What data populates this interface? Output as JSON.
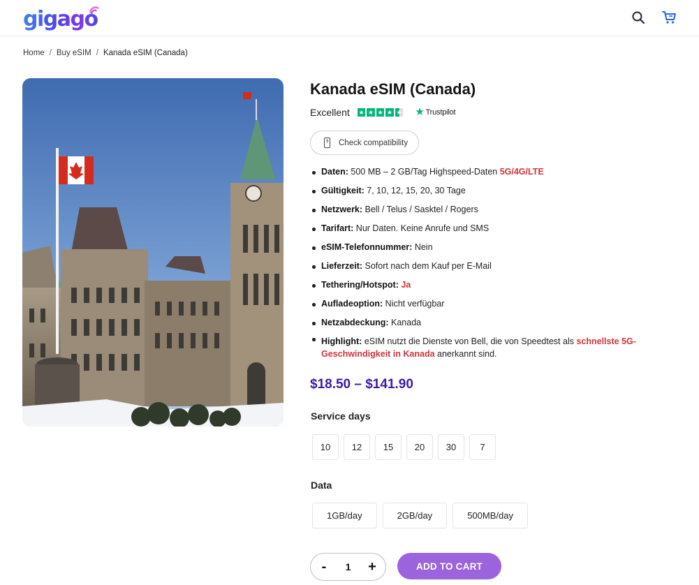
{
  "header": {
    "logo_text": "gigago",
    "search_icon": "search-icon",
    "cart_icon": "cart-icon"
  },
  "breadcrumb": [
    "Home",
    "Buy eSIM",
    "Kanada eSIM (Canada)"
  ],
  "product": {
    "title": "Kanada eSIM (Canada)",
    "rating_label": "Excellent",
    "trustpilot_label": "Trustpilot",
    "rating_stars": 4.5,
    "compat_label": "Check compatibility",
    "features": [
      {
        "label": "Daten:",
        "text": " 500 MB – 2 GB/Tag Highspeed-Daten ",
        "highlight": "5G/4G/LTE",
        "after": ""
      },
      {
        "label": "Gültigkeit:",
        "text": " 7, 10, 12, 15, 20, 30 Tage",
        "highlight": "",
        "after": ""
      },
      {
        "label": "Netzwerk:",
        "text": " Bell / Telus / Sasktel / Rogers",
        "highlight": "",
        "after": ""
      },
      {
        "label": "Tarifart:",
        "text": " Nur Daten. Keine Anrufe und SMS",
        "highlight": "",
        "after": ""
      },
      {
        "label": "eSIM-Telefonnummer:",
        "text": " Nein",
        "highlight": "",
        "after": ""
      },
      {
        "label": "Lieferzeit:",
        "text": " Sofort nach dem Kauf per E-Mail",
        "highlight": "",
        "after": ""
      },
      {
        "label": "Tethering/Hotspot:",
        "text": " ",
        "highlight": "Ja",
        "after": ""
      },
      {
        "label": "Aufladeoption:",
        "text": " Nicht verfügbar",
        "highlight": "",
        "after": ""
      },
      {
        "label": "Netzabdeckung:",
        "text": " Kanada",
        "highlight": "",
        "after": ""
      },
      {
        "label": "Highlight:",
        "text": " eSIM nutzt die Dienste von Bell, die von Speedtest als ",
        "highlight": "schnellste 5G-Geschwindigkeit in Kanada",
        "after": " anerkannt sind."
      }
    ],
    "price": "$18.50 – $141.90",
    "service_days_label": "Service days",
    "service_days": [
      "10",
      "12",
      "15",
      "20",
      "30",
      "7"
    ],
    "data_label": "Data",
    "data_options": [
      "1GB/day",
      "2GB/day",
      "500MB/day"
    ],
    "quantity": "1",
    "qty_minus": "-",
    "qty_plus": "+",
    "add_to_cart_label": "ADD TO CART"
  },
  "colors": {
    "accent_purple": "#9b63dc",
    "price_color": "#3d1aa8",
    "highlight_red": "#d0343b",
    "trustpilot_green": "#00b67a",
    "logo_blue": "#3b82f6"
  }
}
